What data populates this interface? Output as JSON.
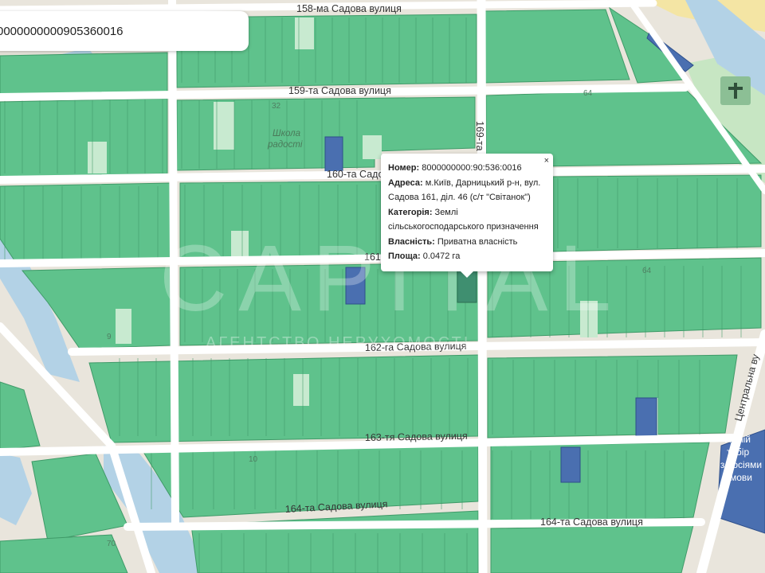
{
  "search": {
    "value": "0000000000905360016"
  },
  "popup": {
    "close_symbol": "×",
    "number_label": "Номер:",
    "number_value": "8000000000:90:536:0016",
    "address_label": "Адреса:",
    "address_line1": "м.Київ, Дарницький р-н, вул.",
    "address_line2": "Садова 161, діл. 46 (с/т \"Світанок\")",
    "category_label": "Категорія:",
    "category_line1": "Землі",
    "category_line2": "сільськогосподарського призначення",
    "ownership_label": "Власність:",
    "ownership_value": "Приватна власність",
    "area_label": "Площа:",
    "area_value": "0.0472 га"
  },
  "streets": {
    "s158": "158-ма Садова вулиця",
    "s159": "159-та Садова вулиця",
    "s160": "160-та Садо",
    "s161": "161",
    "s162": "162-га Садова вулиця",
    "s163": "163-тя Садова вулиця",
    "s164a": "164-та Садова вулиця",
    "s164b": "164-та Садова вулиця",
    "s169": "169-та",
    "central": "Центральна ву"
  },
  "places": {
    "school_line1": "Школа",
    "school_line2": "радості",
    "camp_line1": "Літній",
    "camp_line2": "табір",
    "camp_line3": "з носіями",
    "camp_line4": "мови"
  },
  "numbers": {
    "n32": "32",
    "n64a": "64",
    "n64b": "64",
    "n10": "10",
    "n70": "70",
    "n9": "9"
  },
  "watermark": {
    "brand": "CAPITAL",
    "tagline": "АГЕНТСТВО НЕРУХОМОСТІ"
  },
  "icons": {
    "church": "church-cross-icon",
    "close": "close-icon"
  },
  "colors": {
    "background": "#eae6dd",
    "parcel": "#5fc28c",
    "parcel_stroke": "#3f9a68",
    "parcel_highlight": "#3f8f70",
    "parcel_owned": "#4a6fb0",
    "road": "#ffffff",
    "water": "#a9cde6",
    "park": "#c6e8c8",
    "sand": "#f6e7a8"
  }
}
